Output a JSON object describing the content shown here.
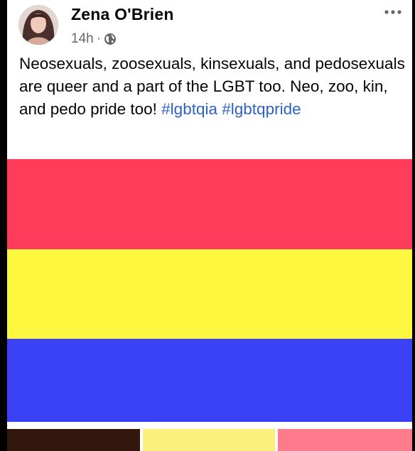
{
  "post": {
    "author": "Zena O'Brien",
    "time": "14h",
    "separator": "·",
    "privacy_icon": "globe-icon",
    "more_icon": "more-options-icon",
    "body_text": "Neosexuals, zoosexuals, kinsexuals, and pedosexuals are queer and a part of the LGBT too. Neo, zoo, kin, and pedo pride too! ",
    "hashtags": [
      "#lgbtqia",
      "#lgbtqpride"
    ]
  },
  "flag_image": {
    "stripes": [
      "#ff3d5a",
      "#fdf740",
      "#3b41f7"
    ]
  },
  "thumbnails": [
    {
      "color": "#33170d"
    },
    {
      "color": "#fbf07c"
    },
    {
      "color": "#ff7b8c"
    }
  ],
  "colors": {
    "hashtag": "#2d62c4",
    "meta_text": "#65676b",
    "text": "#050505"
  }
}
